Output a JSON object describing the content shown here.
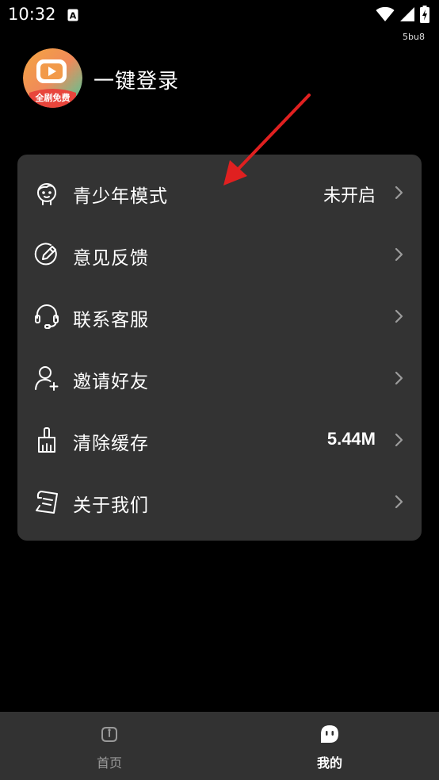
{
  "status_bar": {
    "time": "10:32",
    "sub_text": "5bu8",
    "icons": [
      "a-notification-icon",
      "wifi-icon",
      "signal-icon",
      "battery-charging-icon"
    ]
  },
  "profile": {
    "avatar_badge": "全剧免费",
    "login_label": "一键登录"
  },
  "menu": {
    "items": [
      {
        "icon": "child-face-icon",
        "label": "青少年模式",
        "value": "未开启"
      },
      {
        "icon": "pencil-circle-icon",
        "label": "意见反馈",
        "value": ""
      },
      {
        "icon": "headset-icon",
        "label": "联系客服",
        "value": ""
      },
      {
        "icon": "add-user-icon",
        "label": "邀请好友",
        "value": ""
      },
      {
        "icon": "broom-icon",
        "label": "清除缓存",
        "value": "5.44M"
      },
      {
        "icon": "document-icon",
        "label": "关于我们",
        "value": ""
      }
    ]
  },
  "bottom_nav": {
    "tabs": [
      {
        "icon": "home-icon",
        "label": "首页",
        "active": false
      },
      {
        "icon": "mine-icon",
        "label": "我的",
        "active": true
      }
    ]
  },
  "colors": {
    "background": "#000000",
    "card": "#333333",
    "nav_bar": "#323232",
    "annotation_arrow": "#e02020",
    "inactive_tab": "#9a9a9a"
  }
}
